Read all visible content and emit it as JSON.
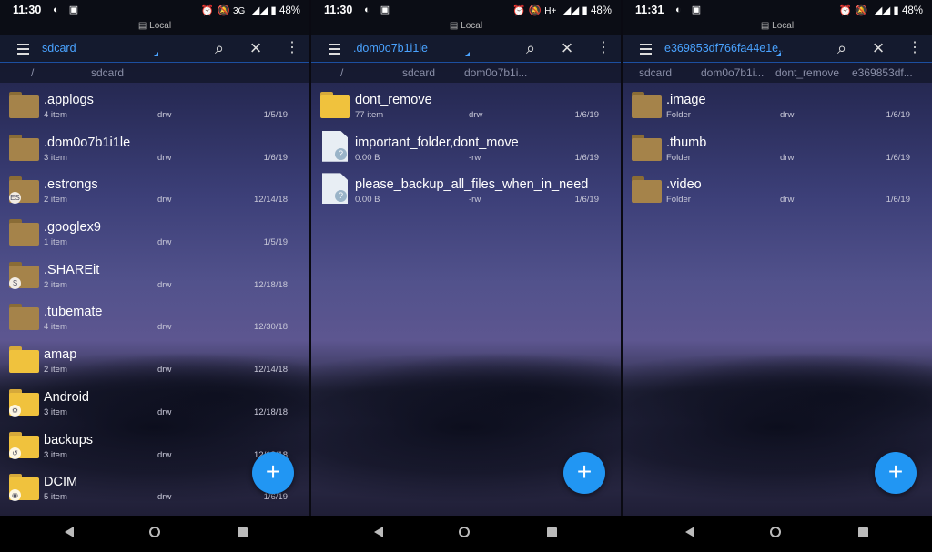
{
  "screens": [
    {
      "status": {
        "time": "11:30",
        "network": "3G",
        "battery": "48%"
      },
      "sub_label": "Local",
      "toolbar": {
        "path": "sdcard"
      },
      "breadcrumbs": [
        "/",
        "sdcard"
      ],
      "items": [
        {
          "name": ".applogs",
          "meta": "4 item",
          "perm": "drw",
          "date": "1/5/19",
          "icon": "folder-dim",
          "badge": ""
        },
        {
          "name": ".dom0o7b1i1le",
          "meta": "3 item",
          "perm": "drw",
          "date": "1/6/19",
          "icon": "folder-dim",
          "badge": ""
        },
        {
          "name": ".estrongs",
          "meta": "2 item",
          "perm": "drw",
          "date": "12/14/18",
          "icon": "folder-dim",
          "badge": "ES"
        },
        {
          "name": ".googlex9",
          "meta": "1 item",
          "perm": "drw",
          "date": "1/5/19",
          "icon": "folder-dim",
          "badge": ""
        },
        {
          "name": ".SHAREit",
          "meta": "2 item",
          "perm": "drw",
          "date": "12/18/18",
          "icon": "folder-dim",
          "badge": "S"
        },
        {
          "name": ".tubemate",
          "meta": "4 item",
          "perm": "drw",
          "date": "12/30/18",
          "icon": "folder-dim",
          "badge": ""
        },
        {
          "name": "amap",
          "meta": "2 item",
          "perm": "drw",
          "date": "12/14/18",
          "icon": "folder",
          "badge": ""
        },
        {
          "name": "Android",
          "meta": "3 item",
          "perm": "drw",
          "date": "12/18/18",
          "icon": "folder",
          "badge": "⚙"
        },
        {
          "name": "backups",
          "meta": "3 item",
          "perm": "drw",
          "date": "12/18/18",
          "icon": "folder",
          "badge": "↺"
        },
        {
          "name": "DCIM",
          "meta": "5 item",
          "perm": "drw",
          "date": "1/6/19",
          "icon": "folder",
          "badge": "◉"
        }
      ]
    },
    {
      "status": {
        "time": "11:30",
        "network": "H+",
        "battery": "48%"
      },
      "sub_label": "Local",
      "toolbar": {
        "path": ".dom0o7b1i1le"
      },
      "breadcrumbs": [
        "/",
        "sdcard",
        "dom0o7b1i..."
      ],
      "items": [
        {
          "name": "dont_remove",
          "meta": "77 item",
          "perm": "drw",
          "date": "1/6/19",
          "icon": "folder",
          "badge": ""
        },
        {
          "name": "important_folder,dont_move",
          "meta": "0.00 B",
          "perm": "-rw",
          "date": "1/6/19",
          "icon": "file",
          "badge": ""
        },
        {
          "name": "please_backup_all_files_when_in_need",
          "meta": "0.00 B",
          "perm": "-rw",
          "date": "1/6/19",
          "icon": "file",
          "badge": ""
        }
      ]
    },
    {
      "status": {
        "time": "11:31",
        "network": "",
        "battery": "48%"
      },
      "sub_label": "Local",
      "toolbar": {
        "path": "e369853df766fa44e1e..."
      },
      "breadcrumbs": [
        "sdcard",
        "dom0o7b1i...",
        "dont_remove",
        "e369853df..."
      ],
      "items": [
        {
          "name": ".image",
          "meta": "Folder",
          "perm": "drw",
          "date": "1/6/19",
          "icon": "folder-dim",
          "badge": ""
        },
        {
          "name": ".thumb",
          "meta": "Folder",
          "perm": "drw",
          "date": "1/6/19",
          "icon": "folder-dim",
          "badge": ""
        },
        {
          "name": ".video",
          "meta": "Folder",
          "perm": "drw",
          "date": "1/6/19",
          "icon": "folder-dim",
          "badge": ""
        }
      ]
    }
  ],
  "fab_label": "+",
  "accent_color": "#2196f3",
  "icons": {
    "menu": "hamburger-menu-icon",
    "search": "search-icon",
    "close": "close-icon",
    "more": "more-vert-icon",
    "nav_back": "back-triangle-icon",
    "nav_home": "home-circle-icon",
    "nav_recent": "recent-square-icon"
  }
}
